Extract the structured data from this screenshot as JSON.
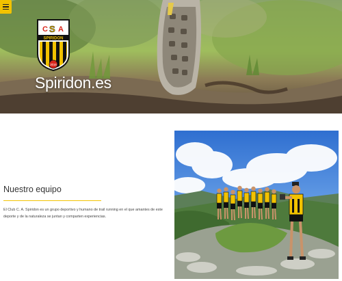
{
  "site": {
    "title": "Spiridon.es",
    "logo": {
      "top_letters": "C S A",
      "banner_text": "SPIRIDON",
      "year": "2016",
      "colors": {
        "gold": "#f2c200",
        "black": "#111111",
        "red": "#d9261c",
        "white": "#ffffff"
      }
    }
  },
  "menu": {
    "icon": "hamburger-menu-icon",
    "color": "#f2c200"
  },
  "team": {
    "heading": "Nuestro equipo",
    "text": "El Club C. A. Spiridon es un grupo deportivo y humano de trail running en el que amantes de este deporte y de la naturaleza se juntan y comparten experiencias."
  },
  "colors": {
    "accent": "#f2c200",
    "text": "#333333"
  }
}
